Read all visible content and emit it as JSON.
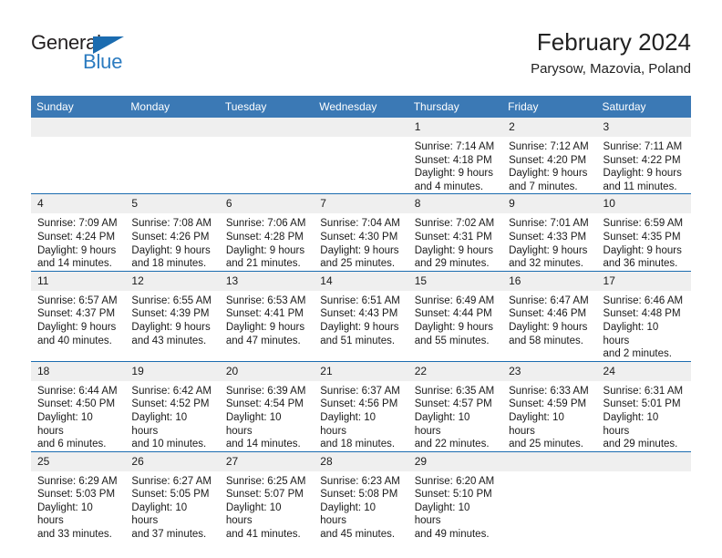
{
  "brand": {
    "name_part1": "General",
    "name_part2": "Blue",
    "triangle_icon": "triangle-icon",
    "colors": {
      "dark": "#231f20",
      "blue": "#2b7bc0",
      "triangle": "#1b6cb0"
    }
  },
  "header": {
    "title": "February 2024",
    "subtitle": "Parysow, Mazovia, Poland"
  },
  "theme": {
    "header_bar": "#3b79b5",
    "row_divider": "#1b6cb0",
    "daynum_band": "#efefef",
    "text": "#1a1a1a"
  },
  "calendar": {
    "weekday_headers": [
      "Sunday",
      "Monday",
      "Tuesday",
      "Wednesday",
      "Thursday",
      "Friday",
      "Saturday"
    ],
    "weeks": [
      [
        {
          "day": ""
        },
        {
          "day": ""
        },
        {
          "day": ""
        },
        {
          "day": ""
        },
        {
          "day": "1",
          "sunrise": "Sunrise: 7:14 AM",
          "sunset": "Sunset: 4:18 PM",
          "daylight1": "Daylight: 9 hours",
          "daylight2": "and 4 minutes."
        },
        {
          "day": "2",
          "sunrise": "Sunrise: 7:12 AM",
          "sunset": "Sunset: 4:20 PM",
          "daylight1": "Daylight: 9 hours",
          "daylight2": "and 7 minutes."
        },
        {
          "day": "3",
          "sunrise": "Sunrise: 7:11 AM",
          "sunset": "Sunset: 4:22 PM",
          "daylight1": "Daylight: 9 hours",
          "daylight2": "and 11 minutes."
        }
      ],
      [
        {
          "day": "4",
          "sunrise": "Sunrise: 7:09 AM",
          "sunset": "Sunset: 4:24 PM",
          "daylight1": "Daylight: 9 hours",
          "daylight2": "and 14 minutes."
        },
        {
          "day": "5",
          "sunrise": "Sunrise: 7:08 AM",
          "sunset": "Sunset: 4:26 PM",
          "daylight1": "Daylight: 9 hours",
          "daylight2": "and 18 minutes."
        },
        {
          "day": "6",
          "sunrise": "Sunrise: 7:06 AM",
          "sunset": "Sunset: 4:28 PM",
          "daylight1": "Daylight: 9 hours",
          "daylight2": "and 21 minutes."
        },
        {
          "day": "7",
          "sunrise": "Sunrise: 7:04 AM",
          "sunset": "Sunset: 4:30 PM",
          "daylight1": "Daylight: 9 hours",
          "daylight2": "and 25 minutes."
        },
        {
          "day": "8",
          "sunrise": "Sunrise: 7:02 AM",
          "sunset": "Sunset: 4:31 PM",
          "daylight1": "Daylight: 9 hours",
          "daylight2": "and 29 minutes."
        },
        {
          "day": "9",
          "sunrise": "Sunrise: 7:01 AM",
          "sunset": "Sunset: 4:33 PM",
          "daylight1": "Daylight: 9 hours",
          "daylight2": "and 32 minutes."
        },
        {
          "day": "10",
          "sunrise": "Sunrise: 6:59 AM",
          "sunset": "Sunset: 4:35 PM",
          "daylight1": "Daylight: 9 hours",
          "daylight2": "and 36 minutes."
        }
      ],
      [
        {
          "day": "11",
          "sunrise": "Sunrise: 6:57 AM",
          "sunset": "Sunset: 4:37 PM",
          "daylight1": "Daylight: 9 hours",
          "daylight2": "and 40 minutes."
        },
        {
          "day": "12",
          "sunrise": "Sunrise: 6:55 AM",
          "sunset": "Sunset: 4:39 PM",
          "daylight1": "Daylight: 9 hours",
          "daylight2": "and 43 minutes."
        },
        {
          "day": "13",
          "sunrise": "Sunrise: 6:53 AM",
          "sunset": "Sunset: 4:41 PM",
          "daylight1": "Daylight: 9 hours",
          "daylight2": "and 47 minutes."
        },
        {
          "day": "14",
          "sunrise": "Sunrise: 6:51 AM",
          "sunset": "Sunset: 4:43 PM",
          "daylight1": "Daylight: 9 hours",
          "daylight2": "and 51 minutes."
        },
        {
          "day": "15",
          "sunrise": "Sunrise: 6:49 AM",
          "sunset": "Sunset: 4:44 PM",
          "daylight1": "Daylight: 9 hours",
          "daylight2": "and 55 minutes."
        },
        {
          "day": "16",
          "sunrise": "Sunrise: 6:47 AM",
          "sunset": "Sunset: 4:46 PM",
          "daylight1": "Daylight: 9 hours",
          "daylight2": "and 58 minutes."
        },
        {
          "day": "17",
          "sunrise": "Sunrise: 6:46 AM",
          "sunset": "Sunset: 4:48 PM",
          "daylight1": "Daylight: 10 hours",
          "daylight2": "and 2 minutes."
        }
      ],
      [
        {
          "day": "18",
          "sunrise": "Sunrise: 6:44 AM",
          "sunset": "Sunset: 4:50 PM",
          "daylight1": "Daylight: 10 hours",
          "daylight2": "and 6 minutes."
        },
        {
          "day": "19",
          "sunrise": "Sunrise: 6:42 AM",
          "sunset": "Sunset: 4:52 PM",
          "daylight1": "Daylight: 10 hours",
          "daylight2": "and 10 minutes."
        },
        {
          "day": "20",
          "sunrise": "Sunrise: 6:39 AM",
          "sunset": "Sunset: 4:54 PM",
          "daylight1": "Daylight: 10 hours",
          "daylight2": "and 14 minutes."
        },
        {
          "day": "21",
          "sunrise": "Sunrise: 6:37 AM",
          "sunset": "Sunset: 4:56 PM",
          "daylight1": "Daylight: 10 hours",
          "daylight2": "and 18 minutes."
        },
        {
          "day": "22",
          "sunrise": "Sunrise: 6:35 AM",
          "sunset": "Sunset: 4:57 PM",
          "daylight1": "Daylight: 10 hours",
          "daylight2": "and 22 minutes."
        },
        {
          "day": "23",
          "sunrise": "Sunrise: 6:33 AM",
          "sunset": "Sunset: 4:59 PM",
          "daylight1": "Daylight: 10 hours",
          "daylight2": "and 25 minutes."
        },
        {
          "day": "24",
          "sunrise": "Sunrise: 6:31 AM",
          "sunset": "Sunset: 5:01 PM",
          "daylight1": "Daylight: 10 hours",
          "daylight2": "and 29 minutes."
        }
      ],
      [
        {
          "day": "25",
          "sunrise": "Sunrise: 6:29 AM",
          "sunset": "Sunset: 5:03 PM",
          "daylight1": "Daylight: 10 hours",
          "daylight2": "and 33 minutes."
        },
        {
          "day": "26",
          "sunrise": "Sunrise: 6:27 AM",
          "sunset": "Sunset: 5:05 PM",
          "daylight1": "Daylight: 10 hours",
          "daylight2": "and 37 minutes."
        },
        {
          "day": "27",
          "sunrise": "Sunrise: 6:25 AM",
          "sunset": "Sunset: 5:07 PM",
          "daylight1": "Daylight: 10 hours",
          "daylight2": "and 41 minutes."
        },
        {
          "day": "28",
          "sunrise": "Sunrise: 6:23 AM",
          "sunset": "Sunset: 5:08 PM",
          "daylight1": "Daylight: 10 hours",
          "daylight2": "and 45 minutes."
        },
        {
          "day": "29",
          "sunrise": "Sunrise: 6:20 AM",
          "sunset": "Sunset: 5:10 PM",
          "daylight1": "Daylight: 10 hours",
          "daylight2": "and 49 minutes."
        },
        {
          "day": ""
        },
        {
          "day": ""
        }
      ]
    ]
  }
}
